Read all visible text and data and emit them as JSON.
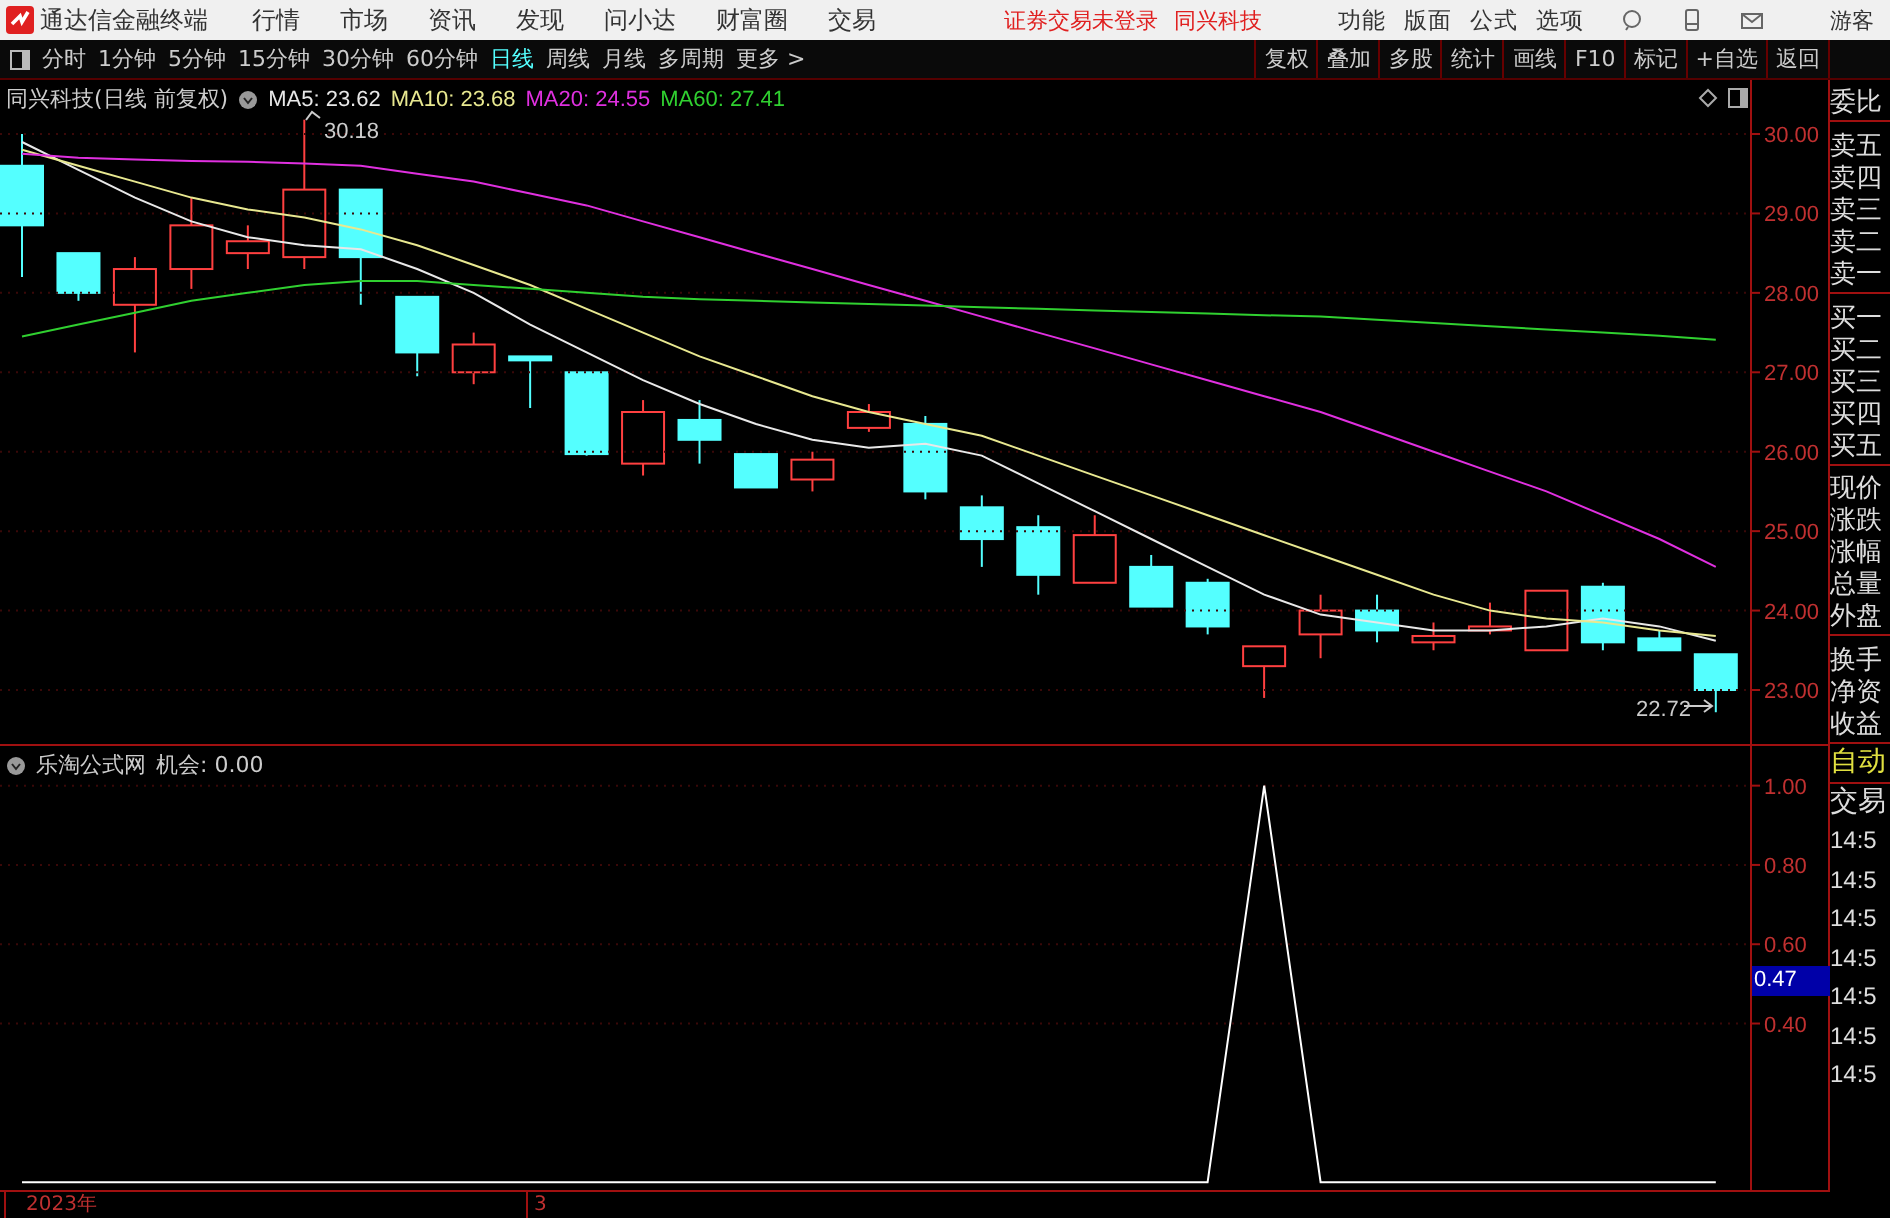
{
  "title_bar": {
    "app_name": "通达信金融终端",
    "menu": [
      "行情",
      "市场",
      "资讯",
      "发现",
      "问小达",
      "财富圈",
      "交易"
    ],
    "status_texts": [
      "证券交易未登录",
      "同兴科技"
    ],
    "right_menu": [
      "功能",
      "版面",
      "公式",
      "选项"
    ],
    "user": "游客"
  },
  "period_bar": {
    "periods": [
      {
        "label": "分时",
        "selected": false
      },
      {
        "label": "1分钟",
        "selected": false
      },
      {
        "label": "5分钟",
        "selected": false
      },
      {
        "label": "15分钟",
        "selected": false
      },
      {
        "label": "30分钟",
        "selected": false
      },
      {
        "label": "60分钟",
        "selected": false
      },
      {
        "label": "日线",
        "selected": true
      },
      {
        "label": "周线",
        "selected": false
      },
      {
        "label": "月线",
        "selected": false
      },
      {
        "label": "多周期",
        "selected": false
      }
    ],
    "more": "更多 >",
    "tools": [
      "复权",
      "叠加",
      "多股",
      "统计",
      "画线",
      "F10",
      "标记",
      "+自选",
      "返回"
    ]
  },
  "price_chart": {
    "title": "同兴科技(日线 前复权)",
    "high_label": "30.18",
    "low_label": "22.72",
    "chart_data": {
      "type": "line",
      "grid": true,
      "ylim": [
        22.32,
        30.68
      ],
      "yticks": [
        {
          "value": 23,
          "label": "23.00"
        },
        {
          "value": 24,
          "label": "24.00"
        },
        {
          "value": 25,
          "label": "25.00"
        },
        {
          "value": 26,
          "label": "26.00"
        },
        {
          "value": 27,
          "label": "27.00"
        },
        {
          "value": 28,
          "label": "28.00"
        },
        {
          "value": 29,
          "label": "29.00"
        },
        {
          "value": 30,
          "label": "30.00"
        }
      ],
      "series": [
        {
          "name": "MA5: 23.62",
          "color": "#e8e8e8",
          "values": [
            29.9,
            29.55,
            29.2,
            28.9,
            28.7,
            28.6,
            28.55,
            28.3,
            28.0,
            27.6,
            27.25,
            26.9,
            26.6,
            26.35,
            26.15,
            26.05,
            26.1,
            25.95,
            25.6,
            25.25,
            24.9,
            24.55,
            24.2,
            23.95,
            23.85,
            23.75,
            23.75,
            23.8,
            23.9,
            23.8,
            23.62
          ]
        },
        {
          "name": "MA10: 23.68",
          "color": "#e8e890",
          "values": [
            29.8,
            29.6,
            29.4,
            29.2,
            29.05,
            28.95,
            28.8,
            28.6,
            28.35,
            28.1,
            27.8,
            27.5,
            27.2,
            26.95,
            26.7,
            26.5,
            26.35,
            26.2,
            25.95,
            25.7,
            25.45,
            25.2,
            24.95,
            24.7,
            24.45,
            24.2,
            24.0,
            23.9,
            23.85,
            23.75,
            23.68
          ]
        },
        {
          "name": "MA20: 24.55",
          "color": "#e030e0",
          "values": [
            29.75,
            29.7,
            29.68,
            29.66,
            29.65,
            29.63,
            29.6,
            29.5,
            29.4,
            29.25,
            29.1,
            28.9,
            28.7,
            28.5,
            28.3,
            28.1,
            27.9,
            27.7,
            27.5,
            27.3,
            27.1,
            26.9,
            26.7,
            26.5,
            26.25,
            26.0,
            25.75,
            25.5,
            25.2,
            24.9,
            24.55
          ]
        },
        {
          "name": "MA60: 27.41",
          "color": "#30d030",
          "values": [
            27.45,
            27.6,
            27.75,
            27.9,
            28.0,
            28.1,
            28.15,
            28.15,
            28.1,
            28.05,
            28.0,
            27.95,
            27.92,
            27.9,
            27.88,
            27.86,
            27.84,
            27.82,
            27.8,
            27.78,
            27.76,
            27.74,
            27.72,
            27.7,
            27.66,
            27.62,
            27.58,
            27.54,
            27.5,
            27.46,
            27.41
          ]
        }
      ]
    }
  },
  "indicator_chart": {
    "title": "乐淘公式网",
    "cursor_value": "0.47",
    "chart_data": {
      "type": "line",
      "grid": true,
      "ylim": [
        -0.03,
        1.1
      ],
      "yticks": [
        {
          "value": 0.4,
          "label": "0.40"
        },
        {
          "value": 0.6,
          "label": "0.60"
        },
        {
          "value": 0.8,
          "label": "0.80"
        },
        {
          "value": 1.0,
          "label": "1.00"
        }
      ],
      "series": [
        {
          "name": "机会: 0.00",
          "color": "#ffffff",
          "values": [
            0,
            0,
            0,
            0,
            0,
            0,
            0,
            0,
            0,
            0,
            0,
            0,
            0,
            0,
            0,
            0,
            0,
            0,
            0,
            0,
            0,
            0,
            1,
            0,
            0,
            0,
            0,
            0,
            0,
            0,
            0
          ]
        }
      ]
    }
  },
  "time_axis": [
    "2023年",
    "3"
  ],
  "quote_panel": {
    "groups": [
      [
        "委比"
      ],
      [
        "卖五",
        "卖四",
        "卖三",
        "卖二",
        "卖一"
      ],
      [
        "买一",
        "买二",
        "买三",
        "买四",
        "买五"
      ],
      [
        "现价",
        "涨跌",
        "涨幅",
        "总量",
        "外盘"
      ],
      [
        "换手",
        "净资",
        "收益"
      ]
    ]
  },
  "trade_panel": {
    "labels": [
      {
        "text": "自动",
        "kind": "highlight"
      },
      {
        "text": "交易",
        "kind": "plain"
      }
    ],
    "times": [
      "14:5",
      "14:5",
      "14:5",
      "14:5",
      "14:5",
      "14:5",
      "14:5"
    ]
  }
}
